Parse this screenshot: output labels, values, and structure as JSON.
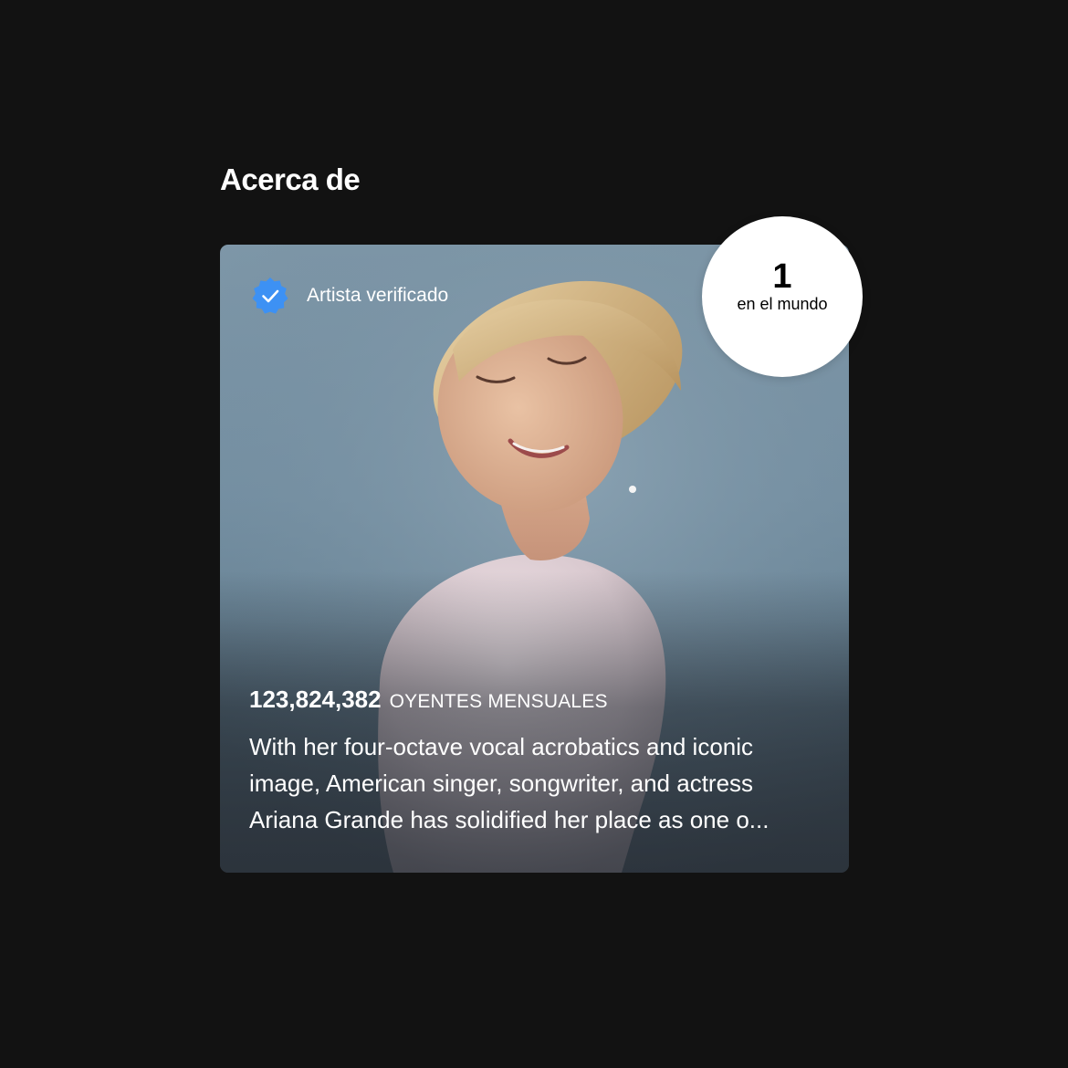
{
  "section": {
    "title": "Acerca de"
  },
  "card": {
    "verified_label": "Artista verificado",
    "verified_icon": "verified-badge-icon",
    "verified_color": "#3d91f4",
    "monthly_listeners_count": "123,824,382",
    "monthly_listeners_label": "OYENTES MENSUALES",
    "bio": "With her four-octave vocal acrobatics and iconic image, American singer, songwriter, and actress Ariana Grande has solidified her place as one o..."
  },
  "rank": {
    "number": "1",
    "label": "en el mundo"
  }
}
